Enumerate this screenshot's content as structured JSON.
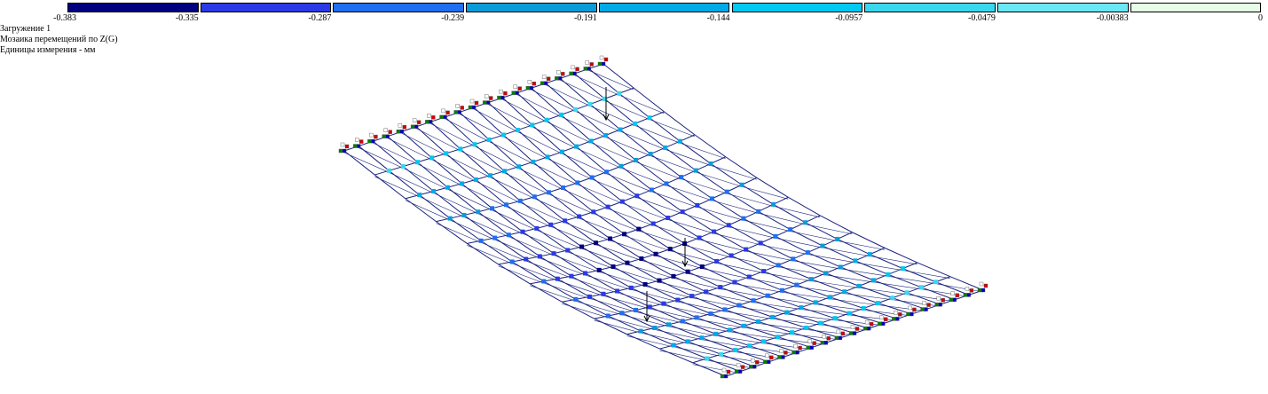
{
  "legend": {
    "colors": [
      "#00007f",
      "#2b3ae6",
      "#1f6ff0",
      "#0a9cd8",
      "#00aae6",
      "#00c8f0",
      "#3ad8ee",
      "#6be8f4",
      "#e6fce6"
    ],
    "ticks": [
      "-0.383",
      "-0.335",
      "-0.287",
      "-0.239",
      "-0.191",
      "-0.144",
      "-0.0957",
      "-0.0479",
      "-0.00383",
      "0"
    ]
  },
  "info": {
    "load_case": "Загружение 1",
    "mosaic_title": "Мозаика перемещений по Z(G)",
    "units": "Единицы измерения - мм"
  },
  "model": {
    "mesh_color": "#1a237e",
    "support_colors": [
      "#d00000",
      "#008000",
      "#0000c0",
      "#ffffff"
    ],
    "grid_rows": 12,
    "grid_cols": 18
  }
}
